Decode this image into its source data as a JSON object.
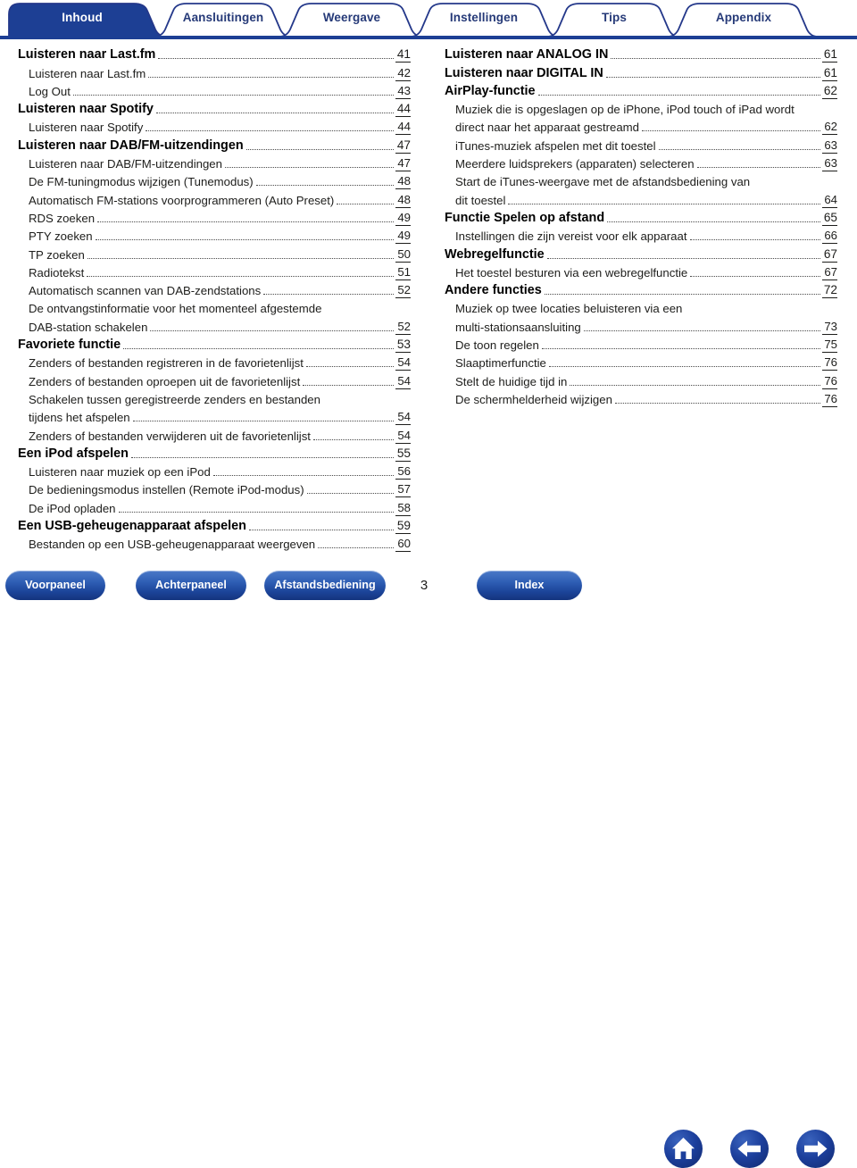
{
  "tabs": [
    {
      "label": "Inhoud",
      "active": true
    },
    {
      "label": "Aansluitingen",
      "active": false
    },
    {
      "label": "Weergave",
      "active": false
    },
    {
      "label": "Instellingen",
      "active": false
    },
    {
      "label": "Tips",
      "active": false
    },
    {
      "label": "Appendix",
      "active": false
    }
  ],
  "colors": {
    "tab_active_bg": "#1d3f94",
    "tab_border": "#24388a",
    "rule": "#1d3f94",
    "text": "#1d1d1b",
    "button_blue": "#1c4499"
  },
  "toc": {
    "left_column": [
      {
        "text": "Luisteren naar Last.fm",
        "page": "41",
        "level": 1
      },
      {
        "text": "Luisteren naar Last.fm",
        "page": "42",
        "level": 2
      },
      {
        "text": "Log Out",
        "page": "43",
        "level": 2
      },
      {
        "text": "Luisteren naar Spotify",
        "page": "44",
        "level": 1
      },
      {
        "text": "Luisteren naar Spotify",
        "page": "44",
        "level": 2
      },
      {
        "text": "Luisteren naar DAB/FM-uitzendingen",
        "page": "47",
        "level": 1
      },
      {
        "text": "Luisteren naar DAB/FM-uitzendingen",
        "page": "47",
        "level": 2
      },
      {
        "text": "De FM-tuningmodus wijzigen (Tunemodus)",
        "page": "48",
        "level": 2
      },
      {
        "text": "Automatisch FM-stations voorprogrammeren (Auto Preset)",
        "page": "48",
        "level": 2
      },
      {
        "text": "RDS zoeken",
        "page": "49",
        "level": 2
      },
      {
        "text": "PTY zoeken",
        "page": "49",
        "level": 2
      },
      {
        "text": "TP zoeken",
        "page": "50",
        "level": 2
      },
      {
        "text": "Radiotekst",
        "page": "51",
        "level": 2
      },
      {
        "text": "Automatisch scannen van DAB-zendstations",
        "page": "52",
        "level": 2
      },
      {
        "text": "De ontvangstinformatie voor het momenteel afgestemde",
        "page": "",
        "level": 2,
        "wrap": true
      },
      {
        "text": "DAB-station schakelen",
        "page": "52",
        "level": 2
      },
      {
        "text": "Favoriete functie",
        "page": "53",
        "level": 1
      },
      {
        "text": "Zenders of bestanden registreren in de favorietenlijst",
        "page": "54",
        "level": 2
      },
      {
        "text": "Zenders of bestanden oproepen uit de favorietenlijst",
        "page": "54",
        "level": 2
      },
      {
        "text": "Schakelen tussen geregistreerde zenders en bestanden",
        "page": "",
        "level": 2,
        "wrap": true
      },
      {
        "text": "tijdens het afspelen",
        "page": "54",
        "level": 2
      },
      {
        "text": "Zenders of bestanden verwijderen uit de favorietenlijst",
        "page": "54",
        "level": 2
      },
      {
        "text": "Een iPod afspelen",
        "page": "55",
        "level": 1
      },
      {
        "text": "Luisteren naar muziek op een iPod",
        "page": "56",
        "level": 2
      },
      {
        "text": "De bedieningsmodus instellen (Remote iPod-modus)",
        "page": "57",
        "level": 2
      },
      {
        "text": "De iPod opladen",
        "page": "58",
        "level": 2
      },
      {
        "text": "Een USB-geheugenapparaat afspelen",
        "page": "59",
        "level": 1
      },
      {
        "text": "Bestanden op een USB-geheugenapparaat weergeven",
        "page": "60",
        "level": 2
      }
    ],
    "right_column": [
      {
        "text": "Luisteren naar ANALOG IN",
        "page": "61",
        "level": 1
      },
      {
        "text": "Luisteren naar DIGITAL IN",
        "page": "61",
        "level": 1
      },
      {
        "text": "AirPlay-functie",
        "page": "62",
        "level": 1
      },
      {
        "text": "Muziek die is opgeslagen op de iPhone, iPod touch of iPad wordt",
        "page": "",
        "level": 2,
        "wrap": true
      },
      {
        "text": "direct naar het apparaat gestreamd",
        "page": "62",
        "level": 2
      },
      {
        "text": "iTunes-muziek afspelen met dit toestel",
        "page": "63",
        "level": 2
      },
      {
        "text": "Meerdere luidsprekers (apparaten) selecteren",
        "page": "63",
        "level": 2
      },
      {
        "text": "Start de iTunes-weergave met de afstandsbediening van",
        "page": "",
        "level": 2,
        "wrap": true
      },
      {
        "text": "dit toestel",
        "page": "64",
        "level": 2
      },
      {
        "text": "Functie Spelen op afstand",
        "page": "65",
        "level": 1
      },
      {
        "text": "Instellingen die zijn vereist voor elk apparaat",
        "page": "66",
        "level": 2
      },
      {
        "text": "Webregelfunctie",
        "page": "67",
        "level": 1
      },
      {
        "text": "Het toestel besturen via een webregelfunctie",
        "page": "67",
        "level": 2
      },
      {
        "text": "Andere functies",
        "page": "72",
        "level": 1
      },
      {
        "text": "Muziek op twee locaties beluisteren via een",
        "page": "",
        "level": 2,
        "wrap": true
      },
      {
        "text": "multi-stationsaansluiting",
        "page": "73",
        "level": 2
      },
      {
        "text": "De toon regelen",
        "page": "75",
        "level": 2
      },
      {
        "text": "Slaaptimerfunctie",
        "page": "76",
        "level": 2
      },
      {
        "text": "Stelt de huidige tijd in",
        "page": "76",
        "level": 2
      },
      {
        "text": "De schermhelderheid wijzigen",
        "page": "76",
        "level": 2
      }
    ]
  },
  "footer": {
    "buttons": [
      {
        "label": "Voorpaneel"
      },
      {
        "label": "Achterpaneel"
      },
      {
        "label": "Afstandsbediening"
      },
      {
        "label": "Index"
      }
    ],
    "page_number": "3",
    "icons": [
      {
        "name": "home-icon"
      },
      {
        "name": "arrow-left-icon"
      },
      {
        "name": "arrow-right-icon"
      }
    ]
  }
}
